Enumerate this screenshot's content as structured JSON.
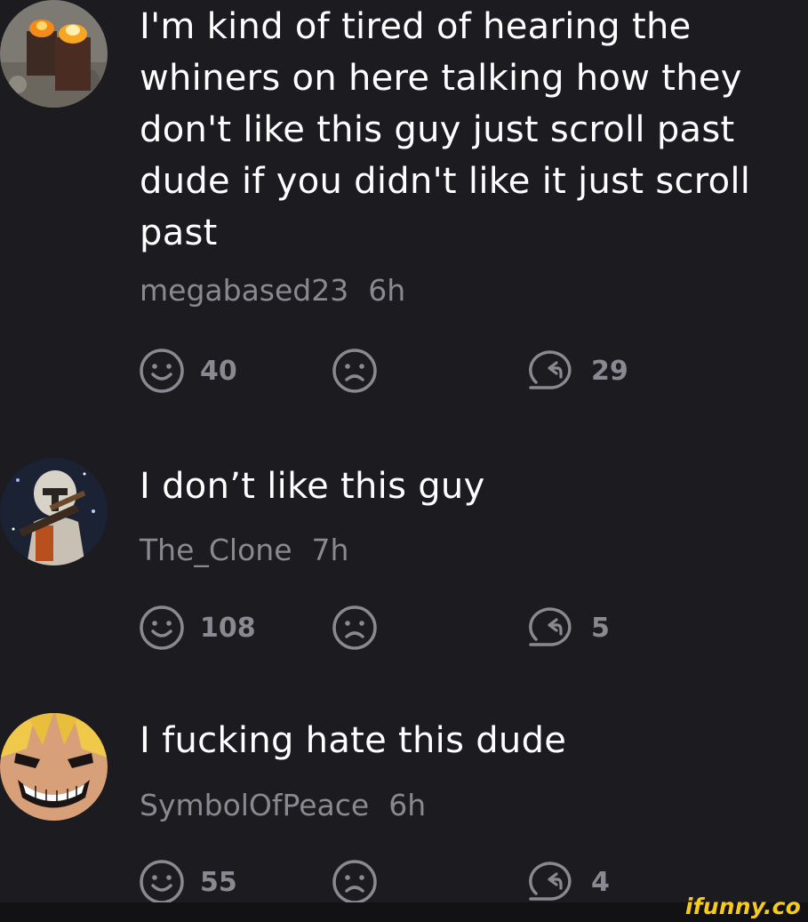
{
  "comments": [
    {
      "text": "I'm kind of tired of hearing the\nwhiners on here talking how they\ndon't like this guy just scroll past\ndude if you didn't like it just scroll\npast",
      "username": "megabased23",
      "time": "6h",
      "likes": "40",
      "replies": "29",
      "avatar": "burning-barrels-avatar"
    },
    {
      "text": "I don’t like this guy",
      "username": "The_Clone",
      "time": "7h",
      "likes": "108",
      "replies": "5",
      "avatar": "clone-trooper-avatar"
    },
    {
      "text": "I fucking hate this dude",
      "username": "SymbolOfPeace",
      "time": "6h",
      "likes": "55",
      "replies": "4",
      "avatar": "all-might-avatar"
    }
  ],
  "icons": {
    "smile": "smile-icon",
    "frown": "frown-icon",
    "reply": "reply-icon"
  },
  "colors": {
    "background": "#1c1b20",
    "text": "#ffffff",
    "muted": "#8a8991",
    "watermark": "#f7c91c"
  },
  "watermark": "ifunny.co"
}
